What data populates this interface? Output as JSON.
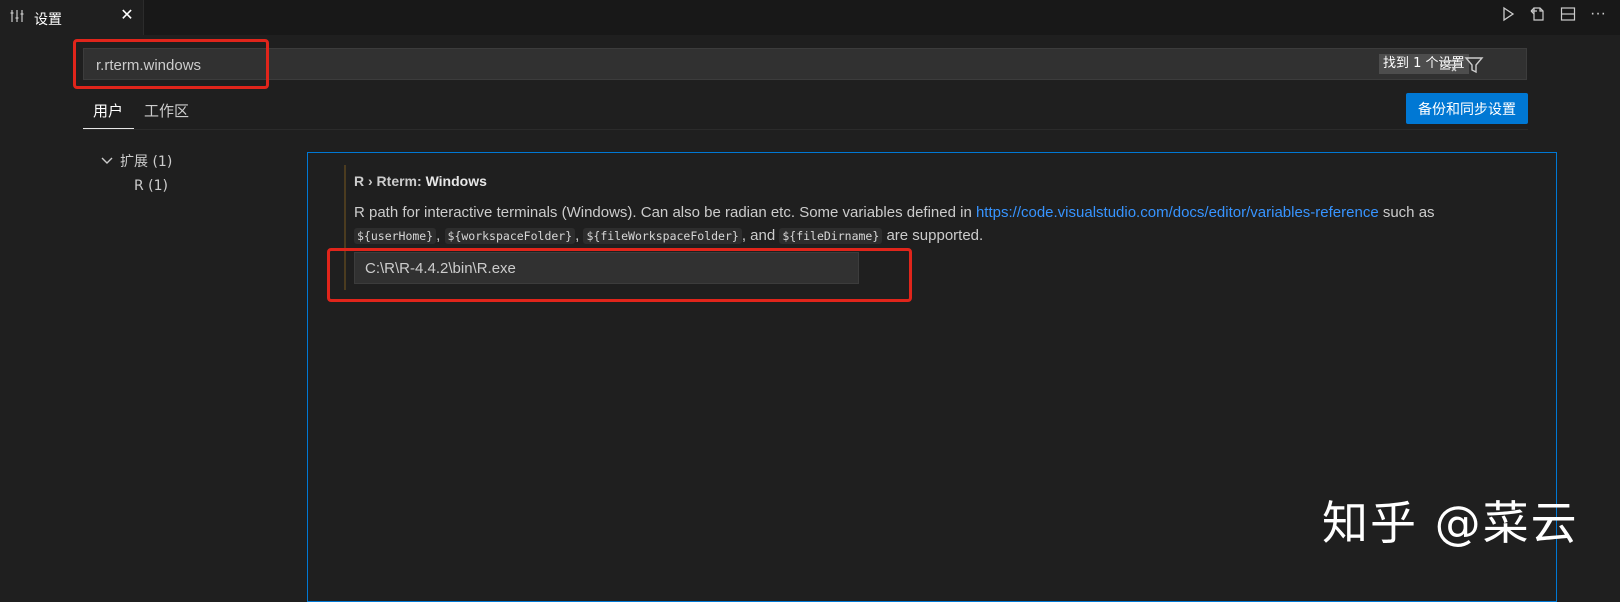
{
  "tab": {
    "title": "设置",
    "close_glyph": "✕",
    "icon": "settings-sliders-icon"
  },
  "tab_actions": [
    {
      "name": "run-icon"
    },
    {
      "name": "open-json-icon"
    },
    {
      "name": "split-editor-icon"
    },
    {
      "name": "more-icon",
      "glyph": "···"
    }
  ],
  "search": {
    "value": "r.rterm.windows",
    "result_count": "找到 1 个设置",
    "clear_filter_icon": "clear-filter-icon",
    "filter_icon": "filter-icon"
  },
  "scope_tabs": {
    "user": "用户",
    "workspace": "工作区"
  },
  "sync_button": "备份和同步设置",
  "toc": {
    "group": "扩展 (1)",
    "item": "R (1)"
  },
  "setting": {
    "category": "R › Rterm: ",
    "name": "Windows",
    "desc_before_link": "R path for interactive terminals (Windows). Can also be radian etc. Some variables defined in ",
    "link": "https://code.visualstudio.com/docs/editor/variables-reference",
    "desc_after_link": " such as ",
    "vars": [
      "${userHome}",
      "${workspaceFolder}",
      "${fileWorkspaceFolder}",
      "${fileDirname}"
    ],
    "sep1": ", ",
    "sep2": ", ",
    "sep3": ", and ",
    "desc_end": " are supported.",
    "value": "C:\\R\\R-4.4.2\\bin\\R.exe"
  },
  "watermark": "知乎 @菜云",
  "colors": {
    "accent": "#0078d4",
    "link": "#3794ff",
    "highlight_box": "#e0251b"
  }
}
